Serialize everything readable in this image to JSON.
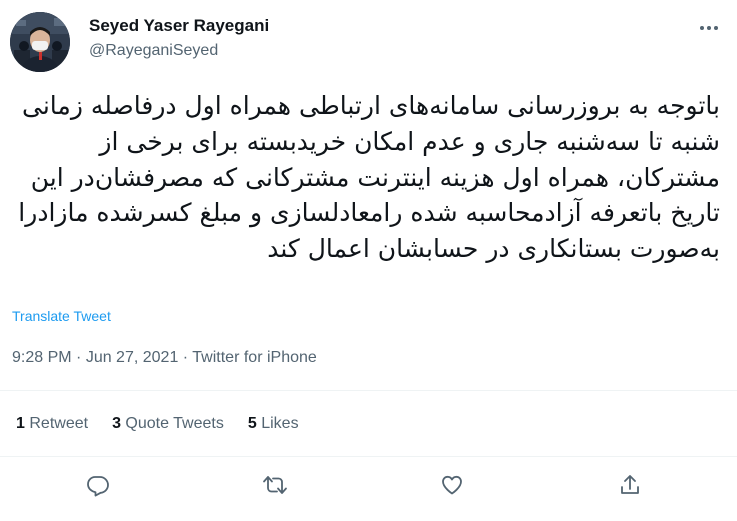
{
  "author": {
    "name": "Seyed Yaser Rayegani",
    "handle": "@RayeganiSeyed"
  },
  "tweet": {
    "text": "باتوجه به بروزرسانی سامانه‌های ارتباطی همراه اول درفاصله زمانی شنبه تا سه‌شنبه جاری و عدم امکان خریدبسته برای برخی از مشترکان، همراه اول هزینه اینترنت مشترکانی که مصرفشان‌در این تاریخ باتعرفه آزادمحاسبه شده رامعادلسازی و مبلغ کسرشده مازادرا به‌صورت بستانکاری در حسابشان اعمال کند",
    "translate_label": "Translate Tweet",
    "time": "9:28 PM",
    "date": "Jun 27, 2021",
    "source": "Twitter for iPhone",
    "separator": " · "
  },
  "stats": {
    "retweets_count": "1",
    "retweets_label": "Retweet",
    "quotes_count": "3",
    "quotes_label": "Quote Tweets",
    "likes_count": "5",
    "likes_label": "Likes"
  },
  "icons": {
    "more": "more-horizontal-icon",
    "reply": "reply-icon",
    "retweet": "retweet-icon",
    "like": "heart-icon",
    "share": "share-icon"
  },
  "colors": {
    "text": "#0f1419",
    "secondary": "#536471",
    "link": "#1d9bf0",
    "divider": "#eff3f4"
  }
}
